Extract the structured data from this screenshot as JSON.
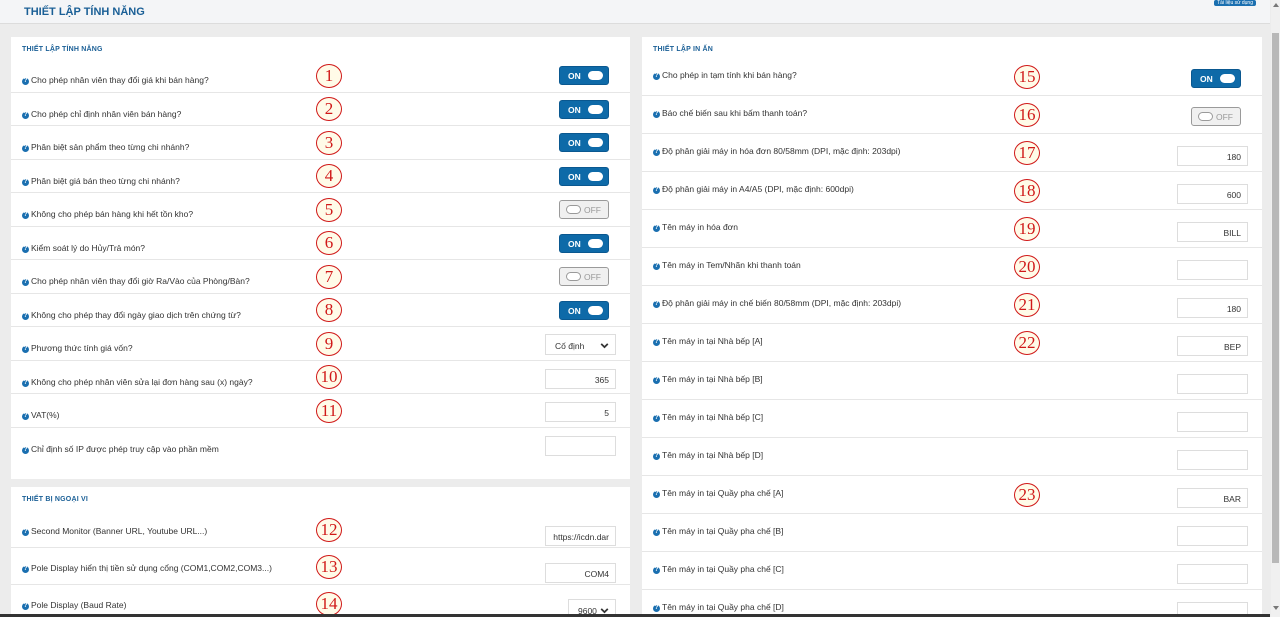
{
  "header": {
    "title": "THIẾT LẬP TÍNH NĂNG",
    "badge": "Tài liệu sử dụng"
  },
  "features": {
    "title": "THIẾT LẬP TÍNH NĂNG",
    "rows": [
      {
        "marker": "1",
        "label": "Cho phép nhân viên thay đổi giá khi bán hàng?",
        "control": "toggle",
        "value": "ON"
      },
      {
        "marker": "2",
        "label": "Cho phép chỉ định nhân viên bán hàng?",
        "control": "toggle",
        "value": "ON"
      },
      {
        "marker": "3",
        "label": "Phân biệt sản phẩm theo từng chi nhánh?",
        "control": "toggle",
        "value": "ON"
      },
      {
        "marker": "4",
        "label": "Phân biệt giá bán theo từng chi nhánh?",
        "control": "toggle",
        "value": "ON"
      },
      {
        "marker": "5",
        "label": "Không cho phép bán hàng khi hết tồn kho?",
        "control": "toggle",
        "value": "OFF"
      },
      {
        "marker": "6",
        "label": "Kiểm soát lý do Hủy/Trả món?",
        "control": "toggle",
        "value": "ON"
      },
      {
        "marker": "7",
        "label": "Cho phép nhân viên thay đổi giờ Ra/Vào của Phòng/Bàn?",
        "control": "toggle",
        "value": "OFF"
      },
      {
        "marker": "8",
        "label": "Không cho phép thay đổi ngày giao dịch trên chứng từ?",
        "control": "toggle",
        "value": "ON"
      },
      {
        "marker": "9",
        "label": "Phương thức tính giá vốn?",
        "control": "select",
        "value": "Cố định"
      },
      {
        "marker": "10",
        "label": "Không cho phép nhân viên sửa lại đơn hàng sau (x) ngày?",
        "control": "text",
        "value": "365"
      },
      {
        "marker": "11",
        "label": "VAT(%)",
        "control": "text",
        "value": "5"
      },
      {
        "marker": "",
        "label": "Chỉ định số IP được phép truy cập vào phần mềm",
        "control": "text",
        "value": ""
      }
    ]
  },
  "devices": {
    "title": "THIẾT BỊ NGOẠI VI",
    "rows": [
      {
        "marker": "12",
        "label": "Second Monitor (Banner URL, Youtube URL...)",
        "control": "text",
        "value": "https://icdn.dar"
      },
      {
        "marker": "13",
        "label": "Pole Display hiển thị tiền sử dụng cổng (COM1,COM2,COM3...)",
        "control": "text",
        "value": "COM4"
      },
      {
        "marker": "14",
        "label": "Pole Display (Baud Rate)",
        "control": "select",
        "value": "9600"
      }
    ]
  },
  "printing": {
    "title": "THIẾT LẬP IN ẤN",
    "rows": [
      {
        "marker": "15",
        "label": "Cho phép in tạm tính khi bán hàng?",
        "control": "toggle",
        "value": "ON"
      },
      {
        "marker": "16",
        "label": "Báo chế biến sau khi bấm thanh toán?",
        "control": "toggle",
        "value": "OFF"
      },
      {
        "marker": "17",
        "label": "Độ phân giải máy in hóa đơn 80/58mm (DPI, mặc định: 203dpi)",
        "control": "text",
        "value": "180"
      },
      {
        "marker": "18",
        "label": "Độ phân giải máy in A4/A5 (DPI, mặc định: 600dpi)",
        "control": "text",
        "value": "600"
      },
      {
        "marker": "19",
        "label": "Tên máy in hóa đơn",
        "control": "text",
        "value": "BILL"
      },
      {
        "marker": "20",
        "label": "Tên máy in Tem/Nhãn khi thanh toán",
        "control": "text",
        "value": ""
      },
      {
        "marker": "21",
        "label": "Độ phân giải máy in chế biến 80/58mm (DPI, mặc định: 203dpi)",
        "control": "text",
        "value": "180"
      },
      {
        "marker": "22",
        "label": "Tên máy in tại Nhà bếp [A]",
        "control": "text",
        "value": "BEP"
      },
      {
        "marker": "",
        "label": "Tên máy in tại Nhà bếp [B]",
        "control": "text",
        "value": ""
      },
      {
        "marker": "",
        "label": "Tên máy in tại Nhà bếp [C]",
        "control": "text",
        "value": ""
      },
      {
        "marker": "",
        "label": "Tên máy in tại Nhà bếp [D]",
        "control": "text",
        "value": ""
      },
      {
        "marker": "23",
        "label": "Tên máy in tại Quầy pha chế [A]",
        "control": "text",
        "value": "BAR"
      },
      {
        "marker": "",
        "label": "Tên máy in tại Quầy pha chế [B]",
        "control": "text",
        "value": ""
      },
      {
        "marker": "",
        "label": "Tên máy in tại Quầy pha chế [C]",
        "control": "text",
        "value": ""
      },
      {
        "marker": "",
        "label": "Tên máy in tại Quầy pha chế [D]",
        "control": "text",
        "value": ""
      }
    ]
  },
  "colors": {
    "accent": "#0e6aa8",
    "title": "#1a5f96",
    "marker": "#d01818"
  }
}
